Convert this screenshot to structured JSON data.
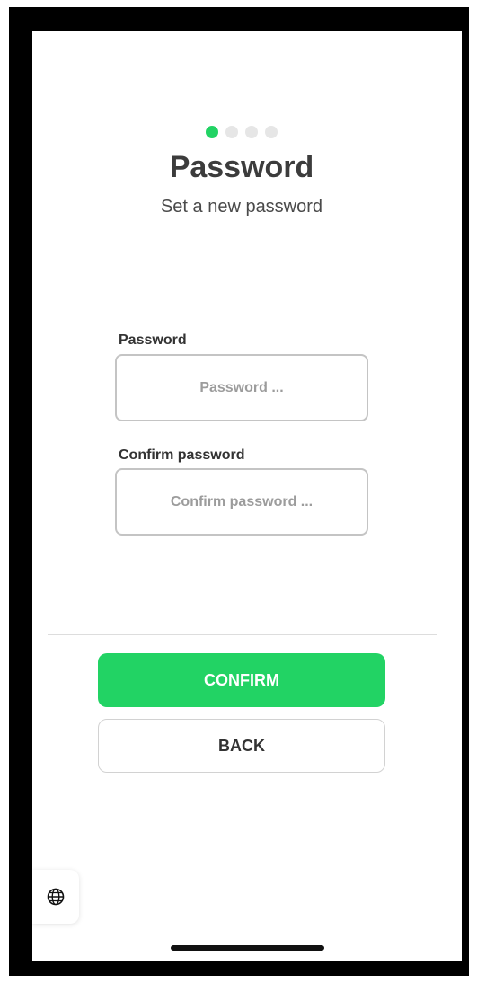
{
  "progress": {
    "total_steps": 4,
    "current_step": 1
  },
  "header": {
    "title": "Password",
    "subtitle": "Set a new password"
  },
  "form": {
    "password": {
      "label": "Password",
      "placeholder": "Password ...",
      "value": ""
    },
    "confirm_password": {
      "label": "Confirm password",
      "placeholder": "Confirm password ...",
      "value": ""
    }
  },
  "actions": {
    "confirm_label": "CONFIRM",
    "back_label": "BACK"
  },
  "language_button": {
    "icon": "globe-icon"
  },
  "colors": {
    "accent": "#22d364",
    "text_dark": "#3c3c3c",
    "placeholder": "#9c9c9c",
    "border": "#c4c4c4"
  }
}
